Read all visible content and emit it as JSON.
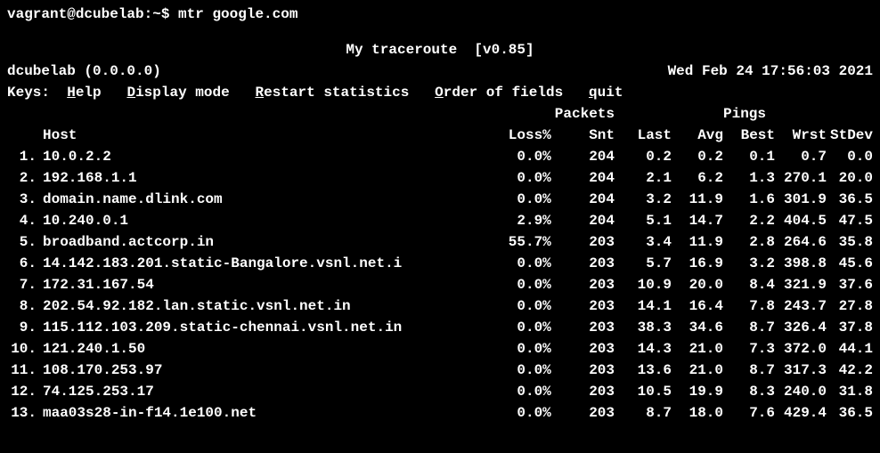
{
  "prompt": "vagrant@dcubelab:~$ mtr google.com",
  "title": "My traceroute  [v0.85]",
  "hostinfo": "dcubelab (0.0.0.0)",
  "timestamp": "Wed Feb 24 17:56:03 2021",
  "keys": {
    "prefix": "Keys:  ",
    "help_u": "H",
    "help_r": "elp",
    "display_u": "D",
    "display_r": "isplay mode",
    "restart_u": "R",
    "restart_r": "estart statistics",
    "order_u": "O",
    "order_r": "rder of fields",
    "quit_u": "q",
    "quit_r": "uit"
  },
  "section_packets": "Packets",
  "section_pings": "Pings",
  "headers": {
    "host": "Host",
    "loss": "Loss%",
    "snt": "Snt",
    "last": "Last",
    "avg": "Avg",
    "best": "Best",
    "wrst": "Wrst",
    "stdev": "StDev"
  },
  "rows": [
    {
      "n": " 1.",
      "host": "10.0.2.2",
      "loss": "0.0%",
      "snt": "204",
      "last": "0.2",
      "avg": "0.2",
      "best": "0.1",
      "wrst": "0.7",
      "stdev": "0.0"
    },
    {
      "n": " 2.",
      "host": "192.168.1.1",
      "loss": "0.0%",
      "snt": "204",
      "last": "2.1",
      "avg": "6.2",
      "best": "1.3",
      "wrst": "270.1",
      "stdev": "20.0"
    },
    {
      "n": " 3.",
      "host": "domain.name.dlink.com",
      "loss": "0.0%",
      "snt": "204",
      "last": "3.2",
      "avg": "11.9",
      "best": "1.6",
      "wrst": "301.9",
      "stdev": "36.5"
    },
    {
      "n": " 4.",
      "host": "10.240.0.1",
      "loss": "2.9%",
      "snt": "204",
      "last": "5.1",
      "avg": "14.7",
      "best": "2.2",
      "wrst": "404.5",
      "stdev": "47.5"
    },
    {
      "n": " 5.",
      "host": "broadband.actcorp.in",
      "loss": "55.7%",
      "snt": "203",
      "last": "3.4",
      "avg": "11.9",
      "best": "2.8",
      "wrst": "264.6",
      "stdev": "35.8"
    },
    {
      "n": " 6.",
      "host": "14.142.183.201.static-Bangalore.vsnl.net.i",
      "loss": "0.0%",
      "snt": "203",
      "last": "5.7",
      "avg": "16.9",
      "best": "3.2",
      "wrst": "398.8",
      "stdev": "45.6"
    },
    {
      "n": " 7.",
      "host": "172.31.167.54",
      "loss": "0.0%",
      "snt": "203",
      "last": "10.9",
      "avg": "20.0",
      "best": "8.4",
      "wrst": "321.9",
      "stdev": "37.6"
    },
    {
      "n": " 8.",
      "host": "202.54.92.182.lan.static.vsnl.net.in",
      "loss": "0.0%",
      "snt": "203",
      "last": "14.1",
      "avg": "16.4",
      "best": "7.8",
      "wrst": "243.7",
      "stdev": "27.8"
    },
    {
      "n": " 9.",
      "host": "115.112.103.209.static-chennai.vsnl.net.in",
      "loss": "0.0%",
      "snt": "203",
      "last": "38.3",
      "avg": "34.6",
      "best": "8.7",
      "wrst": "326.4",
      "stdev": "37.8"
    },
    {
      "n": "10.",
      "host": "121.240.1.50",
      "loss": "0.0%",
      "snt": "203",
      "last": "14.3",
      "avg": "21.0",
      "best": "7.3",
      "wrst": "372.0",
      "stdev": "44.1"
    },
    {
      "n": "11.",
      "host": "108.170.253.97",
      "loss": "0.0%",
      "snt": "203",
      "last": "13.6",
      "avg": "21.0",
      "best": "8.7",
      "wrst": "317.3",
      "stdev": "42.2"
    },
    {
      "n": "12.",
      "host": "74.125.253.17",
      "loss": "0.0%",
      "snt": "203",
      "last": "10.5",
      "avg": "19.9",
      "best": "8.3",
      "wrst": "240.0",
      "stdev": "31.8"
    },
    {
      "n": "13.",
      "host": "maa03s28-in-f14.1e100.net",
      "loss": "0.0%",
      "snt": "203",
      "last": "8.7",
      "avg": "18.0",
      "best": "7.6",
      "wrst": "429.4",
      "stdev": "36.5"
    }
  ]
}
